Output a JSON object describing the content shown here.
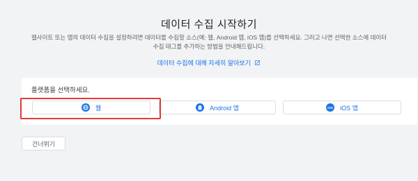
{
  "header": {
    "title": "데이터 수집 시작하기",
    "description": "웹사이트 또는 앱의 데이터 수집을 설정하려면 데이터를 수집할 소스(예: 웹, Android 앱, iOS 앱)를 선택하세요. 그러고 나면 선택한 소스에 데이터 수집 태그를 추가하는 방법을 안내해드립니다.",
    "learn_more": "데이터 수집에 대해 자세히 알아보기",
    "link_icon": "external-link-icon"
  },
  "platform": {
    "prompt": "플랫폼을 선택하세요.",
    "buttons": [
      {
        "label": "웹",
        "icon": "globe-icon"
      },
      {
        "label": "Android 앱",
        "icon": "android-icon"
      },
      {
        "label": "iOS 앱",
        "icon": "ios-icon"
      }
    ]
  },
  "skip_label": "건너뛰기",
  "colors": {
    "accent": "#1a73e8",
    "highlight": "#e53935",
    "background": "#f1f3f4"
  }
}
